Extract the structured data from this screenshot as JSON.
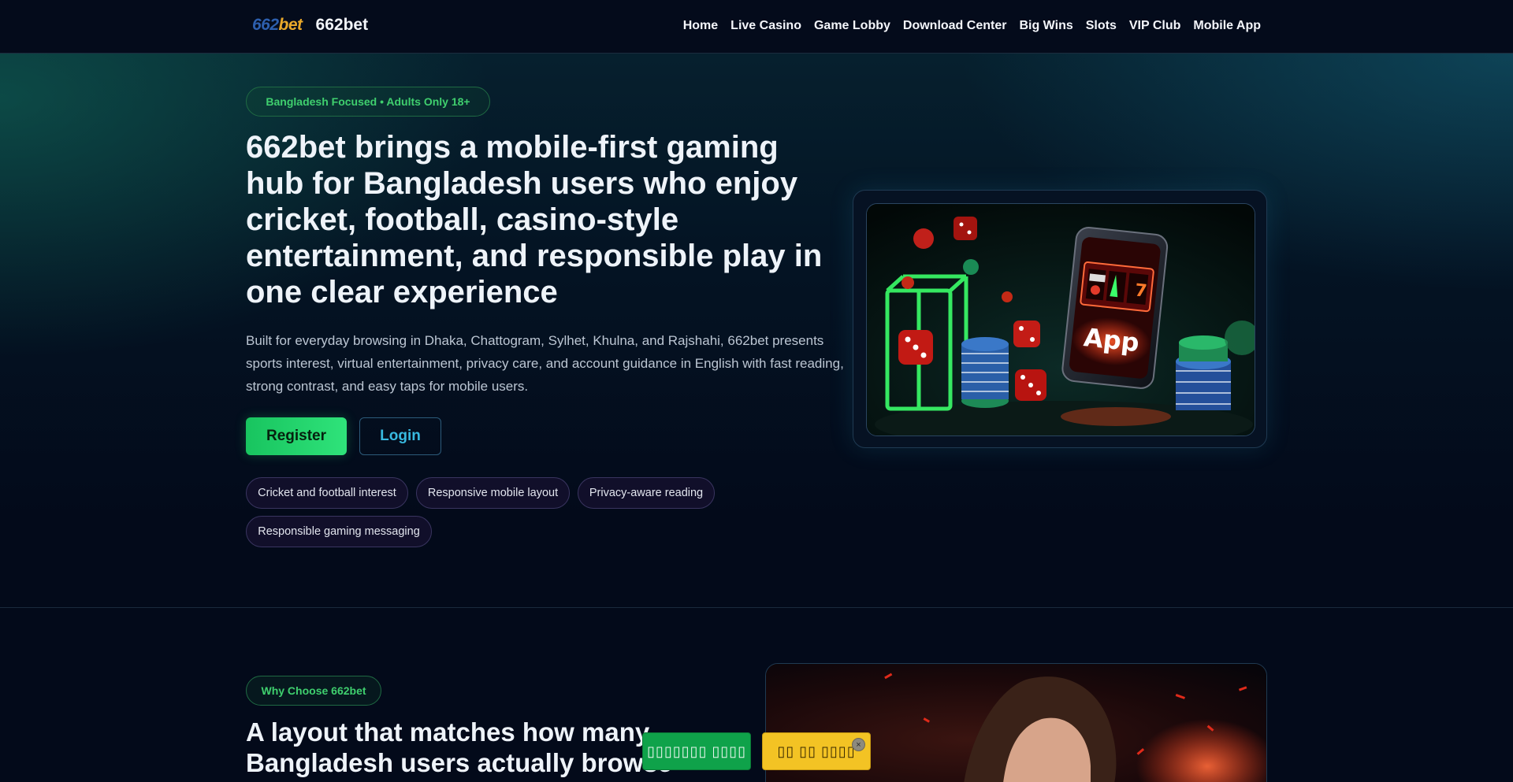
{
  "header": {
    "logo_part1": "662",
    "logo_part2": "bet",
    "brand": "662bet",
    "nav": [
      "Home",
      "Live Casino",
      "Game Lobby",
      "Download Center",
      "Big Wins",
      "Slots",
      "VIP Club",
      "Mobile App"
    ]
  },
  "hero": {
    "badge": "Bangladesh Focused • Adults Only 18+",
    "headline": "662bet brings a mobile-first gaming hub for Bangladesh users who enjoy cricket, football, casino-style entertainment, and responsible play in one clear experience",
    "description": "Built for everyday browsing in Dhaka, Chattogram, Sylhet, Khulna, and Rajshahi, 662bet presents sports interest, virtual entertainment, privacy care, and account guidance in English with fast reading, strong contrast, and easy taps for mobile users.",
    "register_label": "Register",
    "login_label": "Login",
    "tags": [
      "Cricket and football interest",
      "Responsive mobile layout",
      "Privacy-aware reading",
      "Responsible gaming messaging"
    ],
    "image_label": "App"
  },
  "section2": {
    "badge": "Why Choose 662bet",
    "headline": "A layout that matches how many Bangladesh users actually browse"
  },
  "floating": {
    "green_label": "▯▯▯▯▯▯▯ ▯▯▯▯",
    "yellow_label": "▯▯ ▯▯ ▯▯▯▯",
    "close_icon": "×"
  },
  "colors": {
    "accent_green": "#2fe37a",
    "accent_cyan": "#38b9e0",
    "logo_blue": "#2d5fae",
    "logo_gold": "#e9a82a"
  }
}
